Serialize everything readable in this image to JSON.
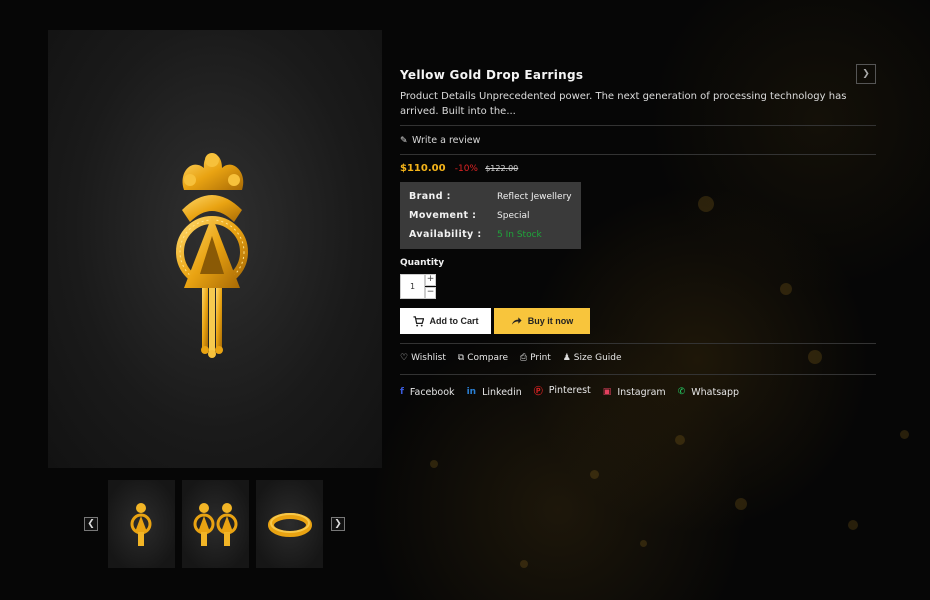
{
  "product": {
    "title": "Yellow Gold Drop Earrings",
    "description": "Product Details Unprecedented power. The next generation of processing technology has arrived. Built into the...",
    "review_link": "Write a review",
    "price": "$110.00",
    "discount": "-10%",
    "old_price": "$122.00"
  },
  "specs": {
    "brand_label": "Brand :",
    "brand_value": "Reflect Jewellery",
    "movement_label": "Movement :",
    "movement_value": "Special",
    "availability_label": "Availability :",
    "availability_value": "5 In Stock"
  },
  "quantity": {
    "label": "Quantity",
    "value": "1",
    "increment": "+",
    "decrement": "−"
  },
  "buttons": {
    "add_to_cart": "Add to Cart",
    "buy_now": "Buy it now"
  },
  "actions": {
    "wishlist": "Wishlist",
    "compare": "Compare",
    "print": "Print",
    "size_guide": "Size Guide"
  },
  "social": {
    "facebook": "Facebook",
    "linkedin": "Linkedin",
    "pinterest": "Pinterest",
    "instagram": "Instagram",
    "whatsapp": "Whatsapp"
  },
  "icons": {
    "next": "chevron-right-icon",
    "prev_thumb": "chevron-left-icon",
    "next_thumb": "chevron-right-icon",
    "review": "pencil-icon",
    "cart": "cart-icon",
    "buy": "share-arrow-icon",
    "wishlist": "heart-icon",
    "compare": "copy-icon",
    "print": "printer-icon",
    "size_guide": "person-icon"
  },
  "colors": {
    "price": "#f4b41a",
    "discount": "#e02424",
    "in_stock": "#1fa53a",
    "buy_button": "#f8c53c",
    "facebook": "#3b5bdb",
    "linkedin": "#2a7fd4",
    "pinterest": "#e02424",
    "instagram": "#e4405f",
    "whatsapp": "#25d366"
  }
}
